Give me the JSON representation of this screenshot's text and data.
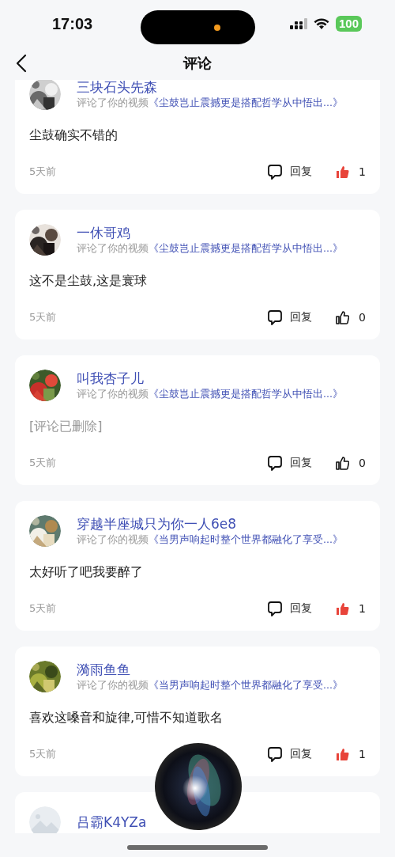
{
  "status_bar": {
    "time": "17:03",
    "battery": "100"
  },
  "nav": {
    "title": "评论"
  },
  "comments": [
    {
      "kind": "picture",
      "user": "三块石头先森",
      "action": "评论了你的视频",
      "video": "《尘鼓岂止震撼更是搭配哲学从中悟出...》",
      "text": "尘鼓确实不错的",
      "deleted": false,
      "time": "5天前",
      "reply": "回复",
      "liked": true,
      "likes": "1"
    },
    {
      "kind": "picture",
      "user": "一休哥鸡",
      "action": "评论了你的视频",
      "video": "《尘鼓岂止震撼更是搭配哲学从中悟出...》",
      "text": "这不是尘鼓,这是寰球",
      "deleted": false,
      "time": "5天前",
      "reply": "回复",
      "liked": false,
      "likes": "0"
    },
    {
      "kind": "picture",
      "user": "叫我杏子儿",
      "action": "评论了你的视频",
      "video": "《尘鼓岂止震撼更是搭配哲学从中悟出...》",
      "text": "[评论已删除]",
      "deleted": true,
      "time": "5天前",
      "reply": "回复",
      "liked": false,
      "likes": "0"
    },
    {
      "kind": "picture",
      "user": "穿越半座城只为你一人6e8",
      "action": "评论了你的视频",
      "video": "《当男声响起时整个世界都融化了享受...》",
      "text": "太好听了吧我要醉了",
      "deleted": false,
      "time": "5天前",
      "reply": "回复",
      "liked": true,
      "likes": "1"
    },
    {
      "kind": "picture",
      "user": "漪雨鱼鱼",
      "action": "评论了你的视频",
      "video": "《当男声响起时整个世界都融化了享受...》",
      "text": "喜欢这嗓音和旋律,可惜不知道歌名",
      "deleted": false,
      "time": "5天前",
      "reply": "回复",
      "liked": true,
      "likes": "1"
    },
    {
      "kind": "placeholder",
      "user": "吕霸K4YZa"
    }
  ]
}
